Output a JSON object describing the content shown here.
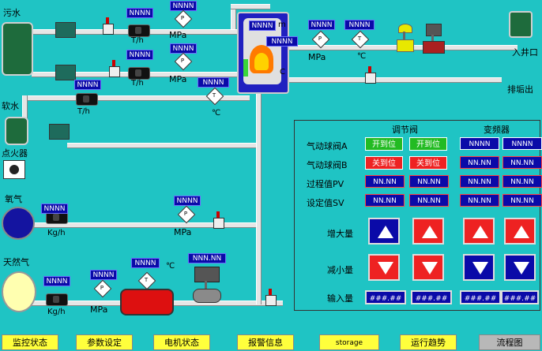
{
  "sources": {
    "sewage": "污水",
    "soft_water": "软水",
    "igniter": "点火器",
    "oxygen": "氧气",
    "natural_gas": "天然气"
  },
  "outputs": {
    "into_well": "入井口",
    "blowdown": "排垢出"
  },
  "instruments": {
    "nnnn": "NNNN",
    "nnn_nn": "NNN.NN",
    "unit_th": "T/h",
    "unit_mpa": "MPa",
    "unit_c": "℃",
    "unit_kgh": "Kg/h",
    "p_symbol": "P",
    "t_symbol": "T",
    "m_fragment": "m",
    "c_fragment": "C"
  },
  "panel": {
    "regulating_valve_title": "调节阀",
    "vfd_title": "变频器",
    "rows": {
      "ball_valve_a": "气动球阀A",
      "ball_valve_b": "气动球阀B",
      "pv": "过程值PV",
      "sv": "设定值SV",
      "increase": "增大量",
      "decrease": "减小量",
      "input": "输入量"
    },
    "open_label": "开到位",
    "closed_label": "关到位",
    "nnnn": "NNNN",
    "nn_nn": "NN.NN",
    "input_mask": "###.##"
  },
  "colors": {
    "background": "#1fc4c4",
    "open": "#22bb22",
    "closed": "#ee2222",
    "display": "#0a0aa8",
    "increase": "#0a0aa8",
    "decrease": "#ee2222"
  },
  "tabs": [
    {
      "label": "监控状态"
    },
    {
      "label": "参数设定"
    },
    {
      "label": "电机状态"
    },
    {
      "label": "报警信息"
    },
    {
      "label": "storage"
    },
    {
      "label": "运行趋势"
    },
    {
      "label": "流程图"
    }
  ]
}
